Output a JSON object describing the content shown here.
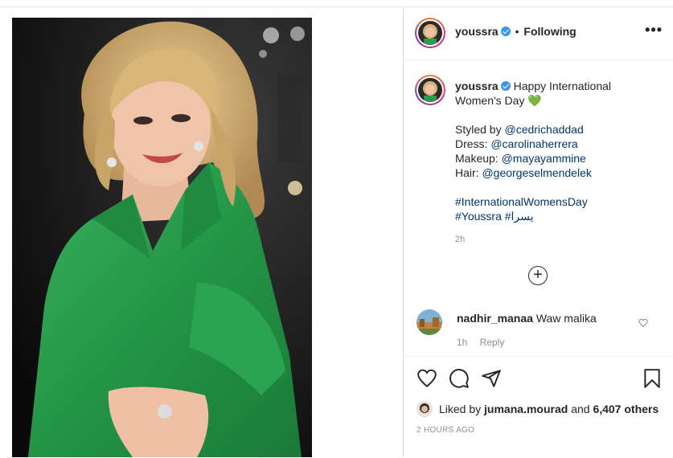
{
  "post": {
    "username": "youssra",
    "follow_status": "Following",
    "more_label": "•••",
    "caption": {
      "username": "youssra",
      "first_line": "Happy International Women's Day",
      "heart_emoji": "💚",
      "styled_by_label": "Styled by",
      "styled_by": "@cedrichaddad",
      "dress_label": "Dress:",
      "dress": "@carolinaherrera",
      "makeup_label": "Makeup:",
      "makeup": "@mayayammine",
      "hair_label": "Hair:",
      "hair": "@georgeselmendelek",
      "hashtag_1": "#InternationalWomensDay",
      "hashtag_2": "#Youssra",
      "hashtag_3": "#يسرا"
    },
    "caption_time": "2h",
    "load_more_icon": "plus-circle-icon",
    "comments": [
      {
        "username": "nadhir_manaa",
        "text": "Waw malika",
        "time": "1h",
        "reply_label": "Reply"
      }
    ],
    "likes": {
      "liked_by_label": "Liked by",
      "liked_by_user": "jumana.mourad",
      "and_label": "and",
      "others": "6,407 others"
    },
    "timestamp": "2 HOURS AGO",
    "icons": [
      "heart-icon",
      "comment-icon",
      "share-icon",
      "bookmark-icon"
    ],
    "colors": {
      "dress_green": "#2e9a4e",
      "verified_blue": "#3897f0",
      "link_blue": "#00376b",
      "muted_gray": "#8e8e8e"
    }
  }
}
